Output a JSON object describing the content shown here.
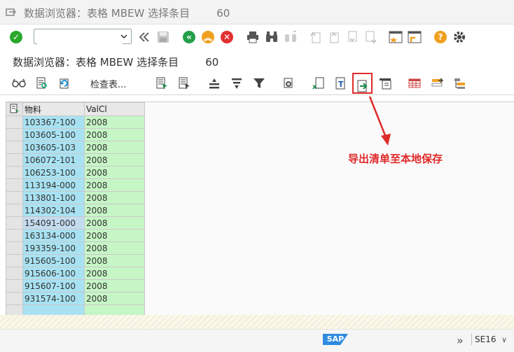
{
  "window": {
    "title": "数据浏览器：表格 MBEW 选择条目",
    "count": "60"
  },
  "command_field": {
    "value": "",
    "placeholder": ""
  },
  "screen": {
    "title": "数据浏览器：表格 MBEW 选择条目",
    "count": "60"
  },
  "app_toolbar": {
    "check_table_label": "检查表..."
  },
  "grid": {
    "columns": [
      "物料",
      "ValCl"
    ],
    "rows": [
      [
        "103367-100",
        "2008"
      ],
      [
        "103605-100",
        "2008"
      ],
      [
        "103605-103",
        "2008"
      ],
      [
        "106072-101",
        "2008"
      ],
      [
        "106253-100",
        "2008"
      ],
      [
        "113194-000",
        "2008"
      ],
      [
        "113801-100",
        "2008"
      ],
      [
        "114302-104",
        "2008"
      ],
      [
        "154091-000",
        "2008"
      ],
      [
        "163134-000",
        "2008"
      ],
      [
        "193359-100",
        "2008"
      ],
      [
        "915605-100",
        "2008"
      ],
      [
        "915606-100",
        "2008"
      ],
      [
        "915607-100",
        "2008"
      ],
      [
        "931574-100",
        "2008"
      ]
    ]
  },
  "annotation": {
    "text": "导出清单至本地保存",
    "color": "#e02a2a"
  },
  "status_bar": {
    "logo": "SAP",
    "chevron": "»",
    "system": "SE16",
    "dropdown": "∨"
  },
  "colors": {
    "material_column": "#a8e2f2",
    "valcl_column": "#c6f5c6",
    "enter_green": "#2aa82a",
    "nav_green": "#22a04a",
    "warn_orange": "#f0a020",
    "cancel_red": "#e03030"
  }
}
